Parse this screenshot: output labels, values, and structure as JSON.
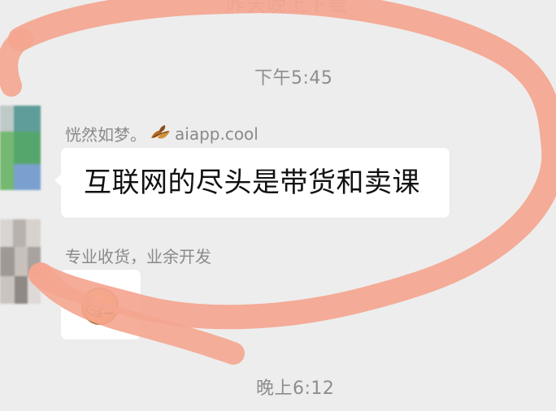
{
  "cut_top_label": "昨天晚上下载",
  "messages": [
    {
      "time": "下午5:45",
      "sender_name": "恍然如梦。",
      "sender_suffix": "aiapp.cool",
      "text": "互联网的尽头是带货和卖课",
      "icon": "leaf-icon"
    },
    {
      "sender_name": "专业收货，业余开发",
      "icon": "facepalm-emoji-icon"
    }
  ],
  "time_2": "晚上6:12",
  "colors": {
    "background": "#ededed",
    "bubble": "#ffffff",
    "muted_text": "#8a8a8a",
    "annotation": "#f3a58f"
  }
}
